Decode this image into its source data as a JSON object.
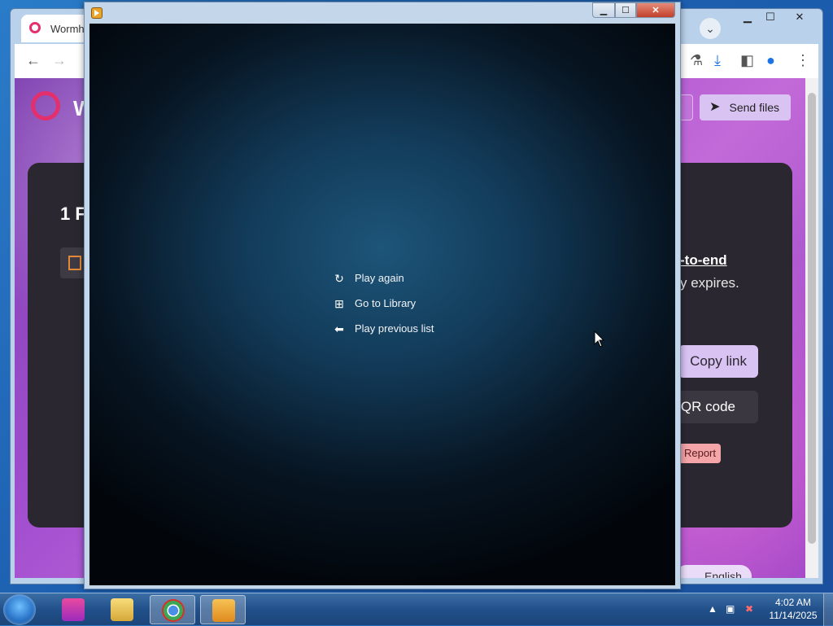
{
  "browser": {
    "tab_title": "Wormh",
    "site_name": "W",
    "send_files_label": "Send files",
    "card_heading": "1 F",
    "e2e_text": "-to-end",
    "expires_text": "y expires.",
    "copy_link_label": "Copy link",
    "qr_code_label": "QR code",
    "report_label": "Report",
    "language_label": "English"
  },
  "player": {
    "menu": [
      {
        "label": "Play again",
        "icon": "replay-icon"
      },
      {
        "label": "Go to Library",
        "icon": "library-icon"
      },
      {
        "label": "Play previous list",
        "icon": "back-arrow-icon"
      }
    ]
  },
  "taskbar": {
    "clock_time": "4:02 AM",
    "clock_date": "11/14/2025",
    "apps": [
      "start-button",
      "firefox-like-app",
      "file-explorer",
      "chrome",
      "media-player"
    ]
  },
  "colors": {
    "player_bg_center": "#1d5579",
    "player_bg_edge": "#02060b",
    "browser_accent": "#d9c3f3",
    "taskbar": "#22508a"
  }
}
